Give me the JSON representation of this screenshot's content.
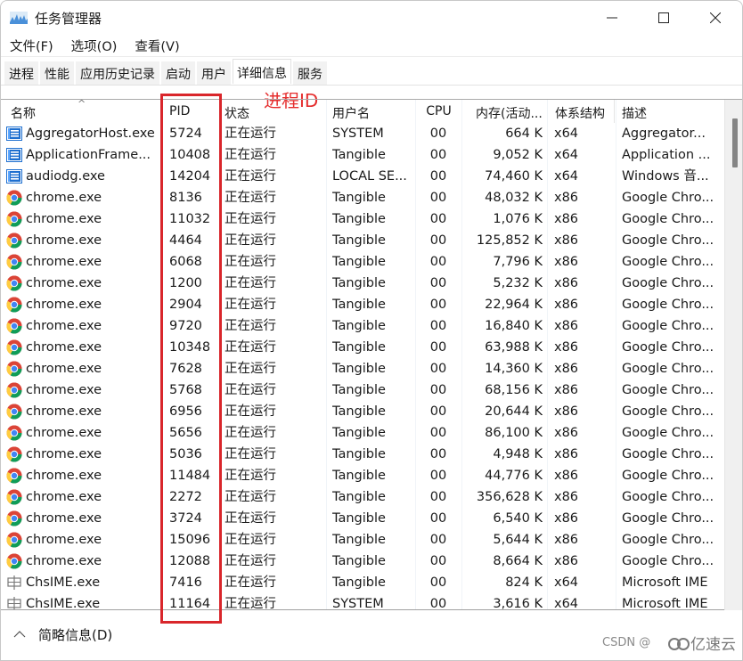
{
  "window": {
    "title": "任务管理器",
    "controls": {
      "minimize": "—",
      "maximize": "☐",
      "close": "✕"
    }
  },
  "menu": [
    "文件(F)",
    "选项(O)",
    "查看(V)"
  ],
  "tabs": [
    {
      "label": "进程",
      "active": false
    },
    {
      "label": "性能",
      "active": false
    },
    {
      "label": "应用历史记录",
      "active": false
    },
    {
      "label": "启动",
      "active": false
    },
    {
      "label": "用户",
      "active": false
    },
    {
      "label": "详细信息",
      "active": true
    },
    {
      "label": "服务",
      "active": false
    }
  ],
  "annotation": {
    "label": "进程ID",
    "color": "#d9262b"
  },
  "table": {
    "columns": {
      "name": "名称",
      "pid": "PID",
      "status": "状态",
      "user": "用户名",
      "cpu": "CPU",
      "memory": "内存(活动...",
      "arch": "体系结构",
      "desc": "描述"
    },
    "rows": [
      {
        "icon": "app",
        "name": "AggregatorHost.exe",
        "pid": "5724",
        "status": "正在运行",
        "user": "SYSTEM",
        "cpu": "00",
        "memory": "664 K",
        "arch": "x64",
        "desc": "Aggregator..."
      },
      {
        "icon": "app",
        "name": "ApplicationFrame...",
        "pid": "10408",
        "status": "正在运行",
        "user": "Tangible",
        "cpu": "00",
        "memory": "9,052 K",
        "arch": "x64",
        "desc": "Application ..."
      },
      {
        "icon": "app",
        "name": "audiodg.exe",
        "pid": "14204",
        "status": "正在运行",
        "user": "LOCAL SE...",
        "cpu": "00",
        "memory": "74,460 K",
        "arch": "x64",
        "desc": "Windows 音..."
      },
      {
        "icon": "chrome",
        "name": "chrome.exe",
        "pid": "8136",
        "status": "正在运行",
        "user": "Tangible",
        "cpu": "00",
        "memory": "48,032 K",
        "arch": "x86",
        "desc": "Google Chro..."
      },
      {
        "icon": "chrome",
        "name": "chrome.exe",
        "pid": "11032",
        "status": "正在运行",
        "user": "Tangible",
        "cpu": "00",
        "memory": "1,076 K",
        "arch": "x86",
        "desc": "Google Chro..."
      },
      {
        "icon": "chrome",
        "name": "chrome.exe",
        "pid": "4464",
        "status": "正在运行",
        "user": "Tangible",
        "cpu": "00",
        "memory": "125,852 K",
        "arch": "x86",
        "desc": "Google Chro..."
      },
      {
        "icon": "chrome",
        "name": "chrome.exe",
        "pid": "6068",
        "status": "正在运行",
        "user": "Tangible",
        "cpu": "00",
        "memory": "7,796 K",
        "arch": "x86",
        "desc": "Google Chro..."
      },
      {
        "icon": "chrome",
        "name": "chrome.exe",
        "pid": "1200",
        "status": "正在运行",
        "user": "Tangible",
        "cpu": "00",
        "memory": "5,232 K",
        "arch": "x86",
        "desc": "Google Chro..."
      },
      {
        "icon": "chrome",
        "name": "chrome.exe",
        "pid": "2904",
        "status": "正在运行",
        "user": "Tangible",
        "cpu": "00",
        "memory": "22,964 K",
        "arch": "x86",
        "desc": "Google Chro..."
      },
      {
        "icon": "chrome",
        "name": "chrome.exe",
        "pid": "9720",
        "status": "正在运行",
        "user": "Tangible",
        "cpu": "00",
        "memory": "16,840 K",
        "arch": "x86",
        "desc": "Google Chro..."
      },
      {
        "icon": "chrome",
        "name": "chrome.exe",
        "pid": "10348",
        "status": "正在运行",
        "user": "Tangible",
        "cpu": "00",
        "memory": "63,988 K",
        "arch": "x86",
        "desc": "Google Chro..."
      },
      {
        "icon": "chrome",
        "name": "chrome.exe",
        "pid": "7628",
        "status": "正在运行",
        "user": "Tangible",
        "cpu": "00",
        "memory": "14,360 K",
        "arch": "x86",
        "desc": "Google Chro..."
      },
      {
        "icon": "chrome",
        "name": "chrome.exe",
        "pid": "5768",
        "status": "正在运行",
        "user": "Tangible",
        "cpu": "00",
        "memory": "68,156 K",
        "arch": "x86",
        "desc": "Google Chro..."
      },
      {
        "icon": "chrome",
        "name": "chrome.exe",
        "pid": "6956",
        "status": "正在运行",
        "user": "Tangible",
        "cpu": "00",
        "memory": "20,644 K",
        "arch": "x86",
        "desc": "Google Chro..."
      },
      {
        "icon": "chrome",
        "name": "chrome.exe",
        "pid": "5656",
        "status": "正在运行",
        "user": "Tangible",
        "cpu": "00",
        "memory": "86,100 K",
        "arch": "x86",
        "desc": "Google Chro..."
      },
      {
        "icon": "chrome",
        "name": "chrome.exe",
        "pid": "5036",
        "status": "正在运行",
        "user": "Tangible",
        "cpu": "00",
        "memory": "4,948 K",
        "arch": "x86",
        "desc": "Google Chro..."
      },
      {
        "icon": "chrome",
        "name": "chrome.exe",
        "pid": "11484",
        "status": "正在运行",
        "user": "Tangible",
        "cpu": "00",
        "memory": "44,776 K",
        "arch": "x86",
        "desc": "Google Chro..."
      },
      {
        "icon": "chrome",
        "name": "chrome.exe",
        "pid": "2272",
        "status": "正在运行",
        "user": "Tangible",
        "cpu": "00",
        "memory": "356,628 K",
        "arch": "x86",
        "desc": "Google Chro..."
      },
      {
        "icon": "chrome",
        "name": "chrome.exe",
        "pid": "3724",
        "status": "正在运行",
        "user": "Tangible",
        "cpu": "00",
        "memory": "6,540 K",
        "arch": "x86",
        "desc": "Google Chro..."
      },
      {
        "icon": "chrome",
        "name": "chrome.exe",
        "pid": "15096",
        "status": "正在运行",
        "user": "Tangible",
        "cpu": "00",
        "memory": "5,644 K",
        "arch": "x86",
        "desc": "Google Chro..."
      },
      {
        "icon": "chrome",
        "name": "chrome.exe",
        "pid": "12088",
        "status": "正在运行",
        "user": "Tangible",
        "cpu": "00",
        "memory": "8,664 K",
        "arch": "x86",
        "desc": "Google Chro..."
      },
      {
        "icon": "ime",
        "name": "ChsIME.exe",
        "pid": "7416",
        "status": "正在运行",
        "user": "Tangible",
        "cpu": "00",
        "memory": "824 K",
        "arch": "x64",
        "desc": "Microsoft IME"
      },
      {
        "icon": "ime",
        "name": "ChsIME.exe",
        "pid": "11164",
        "status": "正在运行",
        "user": "SYSTEM",
        "cpu": "00",
        "memory": "3,616 K",
        "arch": "x64",
        "desc": "Microsoft IME"
      }
    ]
  },
  "footer": {
    "fewer_details_label": "简略信息(D)",
    "caret": "^"
  },
  "watermark": {
    "text1": "CSDN @",
    "text2": "亿速云"
  }
}
